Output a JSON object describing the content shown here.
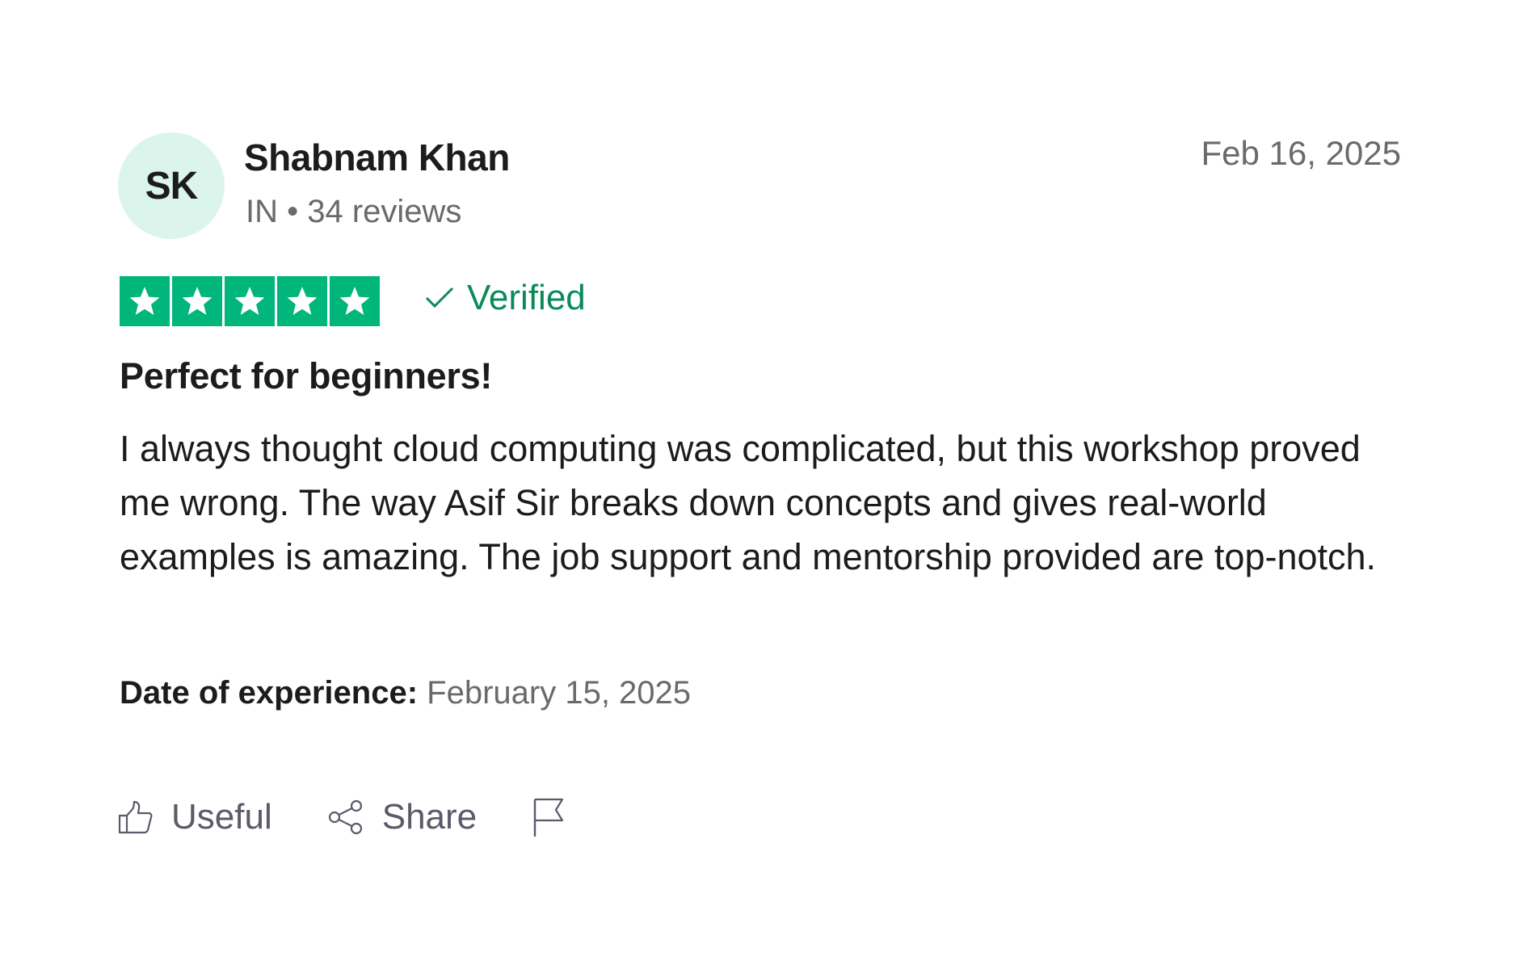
{
  "reviewer": {
    "initials": "SK",
    "name": "Shabnam Khan",
    "meta": "IN • 34 reviews"
  },
  "review": {
    "date": "Feb 16, 2025",
    "rating": 5,
    "rating_max": 5,
    "verified_label": "Verified",
    "title": "Perfect for beginners!",
    "body": "I always thought cloud computing was complicated, but this workshop proved me wrong. The way Asif Sir breaks down concepts and gives real-world examples is amazing. The job support and mentorship provided are top-notch.",
    "experience_label": "Date of experience:",
    "experience_date": "February 15, 2025"
  },
  "actions": {
    "useful_label": "Useful",
    "share_label": "Share",
    "useful_icon": "thumbs-up-icon",
    "share_icon": "share-icon",
    "report_icon": "flag-icon"
  },
  "colors": {
    "star_green": "#00b67a",
    "verified_green": "#0a8a5a",
    "avatar_bg": "#dcf5ec"
  }
}
